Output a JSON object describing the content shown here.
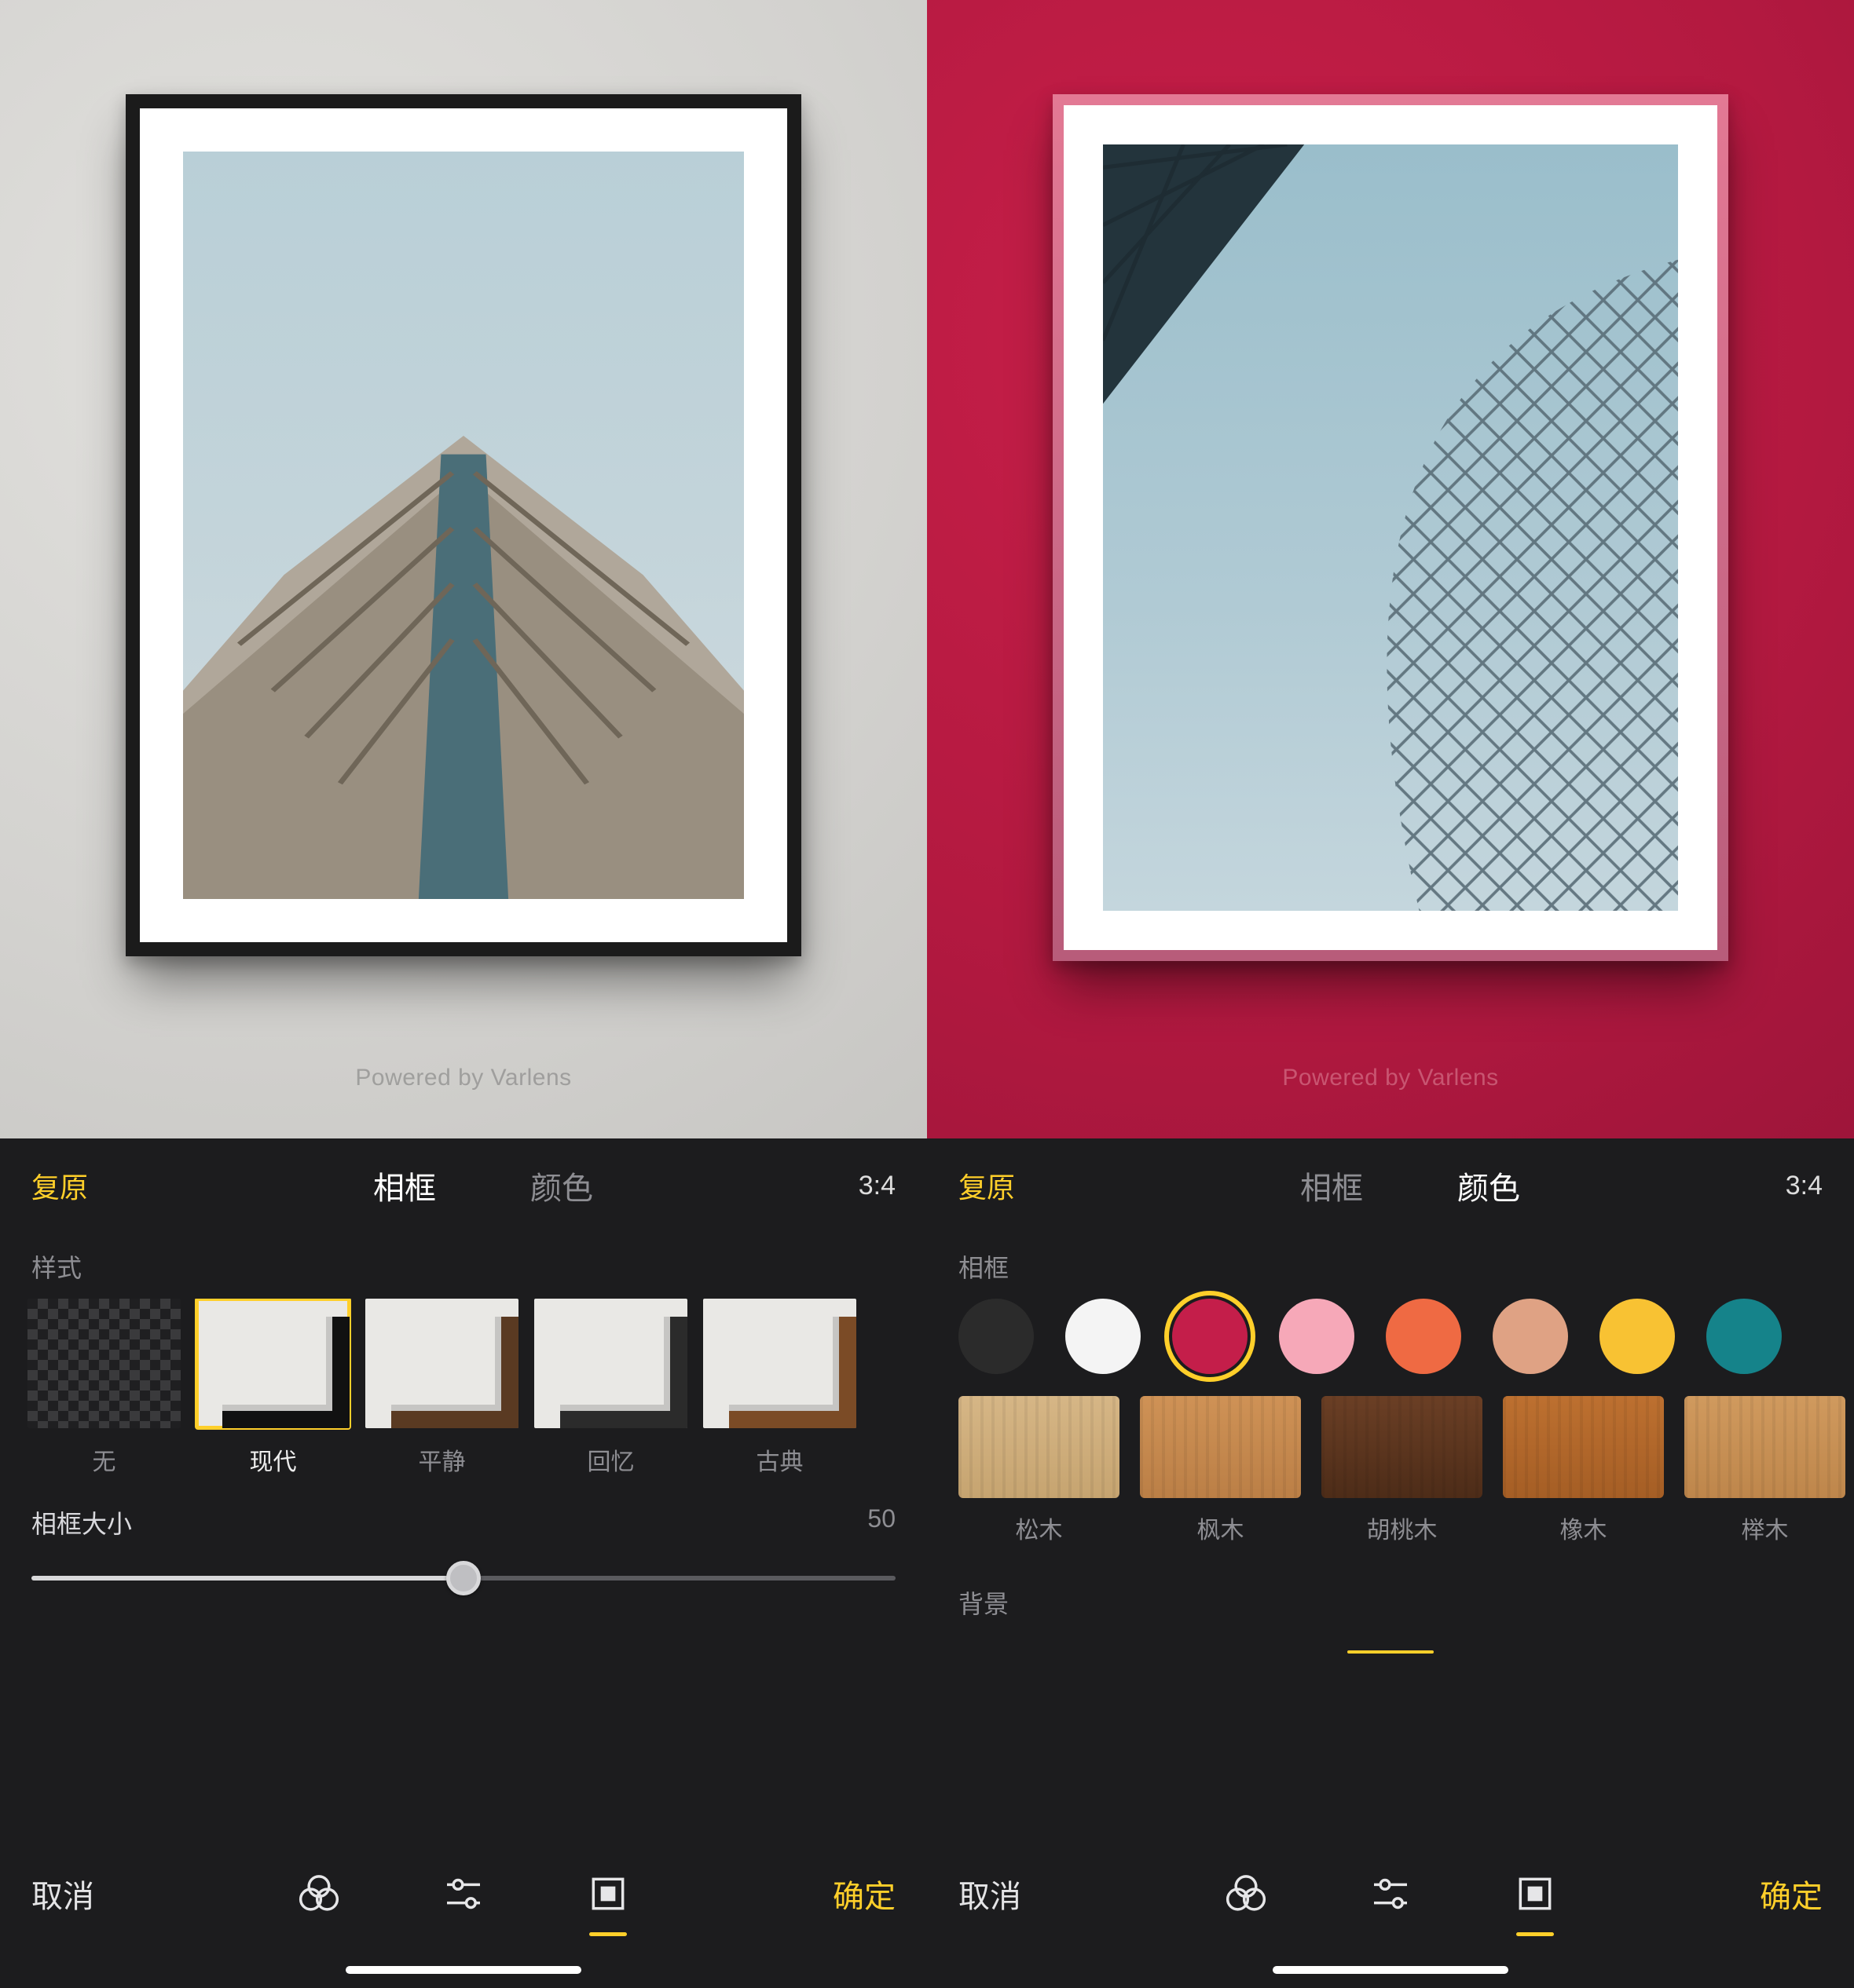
{
  "watermark": "Powered by Varlens",
  "left": {
    "reset": "复原",
    "tab_frame": "相框",
    "tab_color": "颜色",
    "active_tab": "frame",
    "ratio": "3:4",
    "style_section": "样式",
    "styles": [
      {
        "id": "none",
        "label": "无"
      },
      {
        "id": "modern",
        "label": "现代",
        "selected": true
      },
      {
        "id": "calm",
        "label": "平静"
      },
      {
        "id": "memory",
        "label": "回忆"
      },
      {
        "id": "classic",
        "label": "古典"
      }
    ],
    "size_label": "相框大小",
    "size_value": "50",
    "cancel": "取消",
    "confirm": "确定"
  },
  "right": {
    "reset": "复原",
    "tab_frame": "相框",
    "tab_color": "颜色",
    "active_tab": "color",
    "ratio": "3:4",
    "frame_section": "相框",
    "swatches": [
      {
        "id": "black",
        "hex": "#2b2b2b"
      },
      {
        "id": "white",
        "hex": "#f4f4f4"
      },
      {
        "id": "crimson",
        "hex": "#c41e4a",
        "selected": true
      },
      {
        "id": "pink",
        "hex": "#f6a8b8"
      },
      {
        "id": "orange",
        "hex": "#ef6a43"
      },
      {
        "id": "tan",
        "hex": "#dfa284"
      },
      {
        "id": "yellow",
        "hex": "#f8c233"
      },
      {
        "id": "teal",
        "hex": "#15838a"
      }
    ],
    "woods": [
      {
        "id": "pine",
        "label": "松木",
        "c1": "#d6b686",
        "c2": "#c6a470"
      },
      {
        "id": "maple",
        "label": "枫木",
        "c1": "#cf9256",
        "c2": "#bb7f46"
      },
      {
        "id": "walnut",
        "label": "胡桃木",
        "c1": "#6b3f25",
        "c2": "#4d2c18"
      },
      {
        "id": "oak",
        "label": "橡木",
        "c1": "#bd7030",
        "c2": "#a55e25"
      },
      {
        "id": "beech",
        "label": "榉木",
        "c1": "#d09a5e",
        "c2": "#be864b"
      }
    ],
    "bg_section": "背景",
    "cancel": "取消",
    "confirm": "确定"
  },
  "toolbar_icons": [
    "filters-icon",
    "adjust-icon",
    "frame-icon"
  ]
}
